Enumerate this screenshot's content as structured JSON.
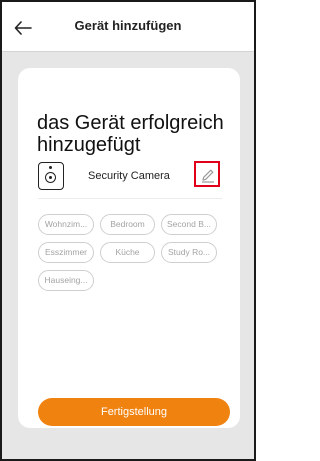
{
  "header": {
    "title": "Gerät hinzufügen",
    "back_icon": "arrow-left-icon"
  },
  "card": {
    "headline": "das Gerät erfolgreich hinzugefügt",
    "device": {
      "icon": "security-camera-icon",
      "name": "Security Camera",
      "edit_icon": "pencil-icon"
    },
    "rooms": [
      "Wohnzim...",
      "Bedroom",
      "Second B...",
      "Esszimmer",
      "Küche",
      "Study Ro...",
      "Hauseing..."
    ],
    "finish_label": "Fertigstellung"
  },
  "colors": {
    "accent": "#f0820f",
    "highlight_border": "#e1001a"
  }
}
